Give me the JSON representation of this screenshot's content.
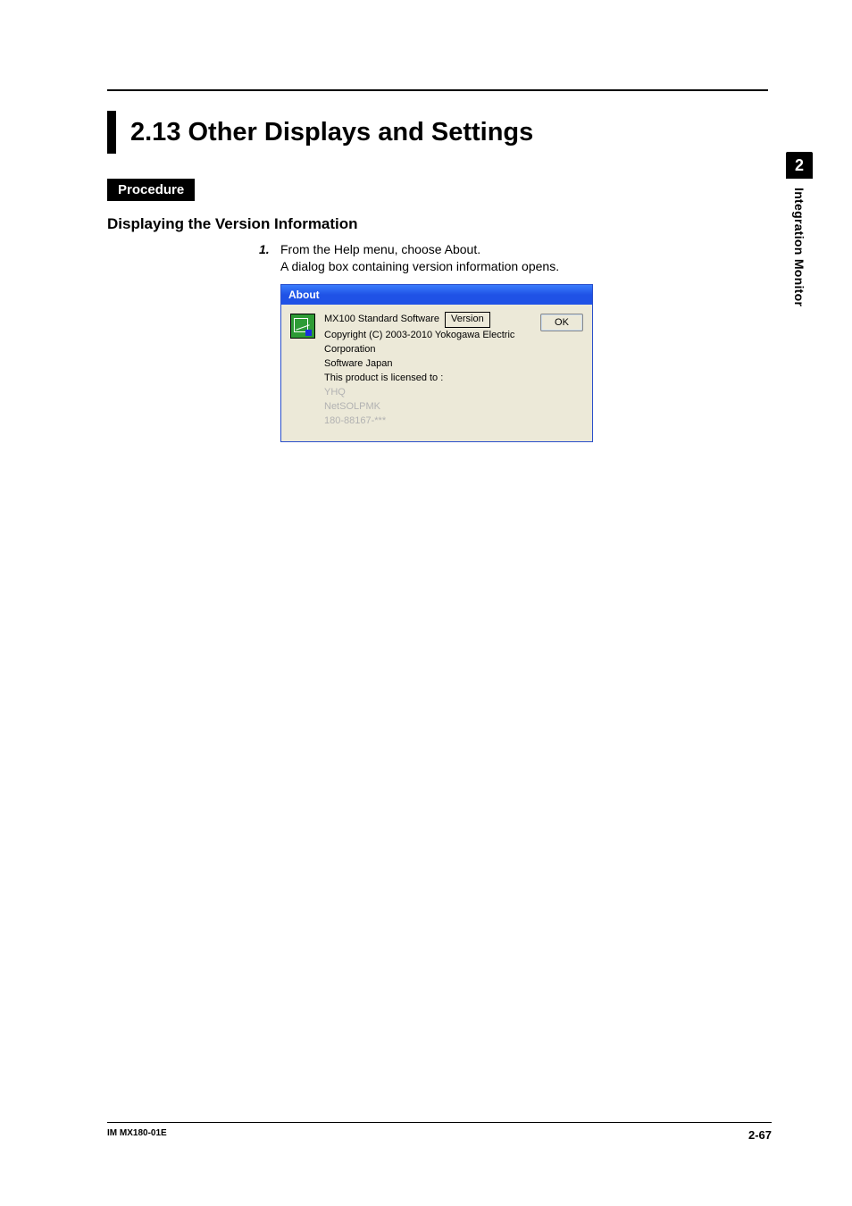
{
  "title": "2.13   Other Displays and Settings",
  "procedure_label": "Procedure",
  "subheading": "Displaying the Version Information",
  "step": {
    "num": "1.",
    "text": "From the Help menu, choose About.",
    "desc": "A dialog box containing version information opens."
  },
  "dialog": {
    "title": "About",
    "product": "MX100 Standard Software",
    "version_label": "Version",
    "copyright": "Copyright (C) 2003-2010 Yokogawa Electric Corporation",
    "software_label": "Software Japan",
    "licensed_label": "This product is licensed to :",
    "licensee1": "YHQ",
    "licensee2": "NetSOLPMK",
    "licensee3": "180-88167-***",
    "ok_label": "OK"
  },
  "side": {
    "num": "2",
    "label": "Integration Monitor"
  },
  "footer": {
    "left": "IM MX180-01E",
    "right": "2-67"
  }
}
